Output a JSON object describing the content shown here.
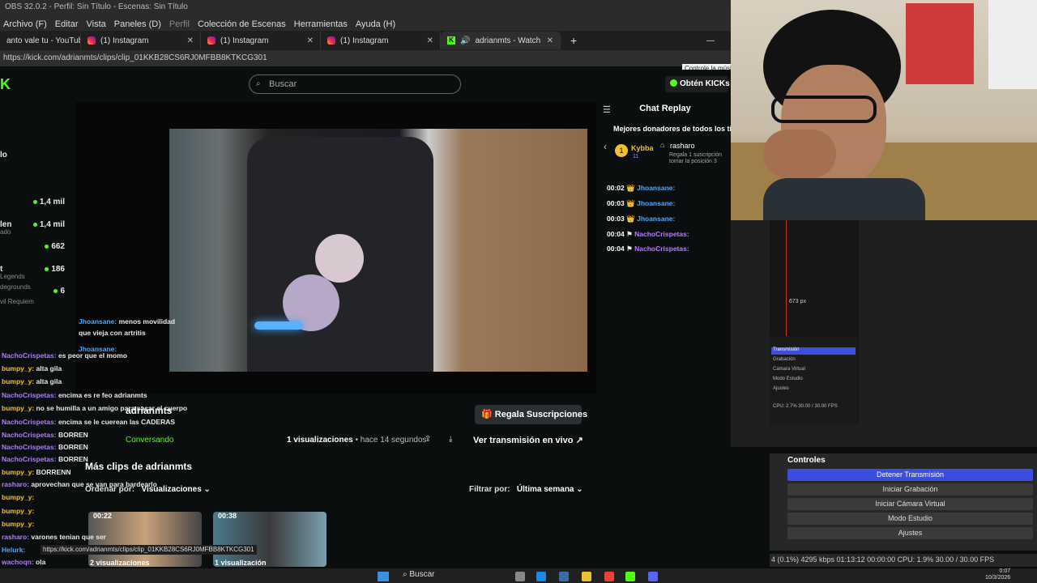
{
  "obs": {
    "title": "OBS 32.0.2 - Perfil: Sin Título - Escenas: Sin Título",
    "menu": [
      "Archivo (F)",
      "Editar",
      "Vista",
      "Paneles (D)",
      "Perfil",
      "Colección de Escenas",
      "Herramientas",
      "Ayuda (H)"
    ],
    "preview_px": "673 px",
    "mini_rows": [
      "Transmisión",
      "Grabación",
      "Cámara Virtual",
      "Modo Estudio",
      "Ajustes"
    ],
    "mini_status": "CPU: 2.7%   30.00 / 30.00 FPS",
    "controls_title": "Controles",
    "buttons": [
      "Detener Transmisión",
      "Iniciar Grabación",
      "Iniciar Cámara Virtual",
      "Modo Estudio",
      "Ajustes"
    ],
    "status": "4 (0.1%)   4295 kbps   01:13:12   00:00:00   CPU: 1.9%   30.00 / 30.00 FPS"
  },
  "browser": {
    "tabs": [
      {
        "label": "anto vale tu - YouTube",
        "icon": "youtube"
      },
      {
        "label": "(1) Instagram",
        "icon": "instagram"
      },
      {
        "label": "(1) Instagram",
        "icon": "instagram"
      },
      {
        "label": "(1) Instagram",
        "icon": "instagram"
      },
      {
        "label": "adrianmts - Watch clips on Ki",
        "icon": "kick"
      }
    ],
    "url": "https://kick.com/adrianmts/clips/clip_01KKB28CS6RJ0MFBB8KTKCG301",
    "tooltip": "Controle la músic",
    "status_url": "https://kick.com/adrianmts/clips/clip_01KKB28CS6RJ0MFBB8KTKCG301"
  },
  "kick": {
    "logo": "K",
    "search_placeholder": "Buscar",
    "get_kicks": "Obtén KICKs",
    "sidebar": [
      {
        "name": "lo",
        "sub": "",
        "value": ""
      },
      {
        "name": "",
        "sub": "",
        "value": "1,4 mil"
      },
      {
        "name": "len",
        "sub": "ado",
        "value": "1,4 mil"
      },
      {
        "name": "",
        "sub": "",
        "value": "662"
      },
      {
        "name": "t",
        "sub": "Legends",
        "value": "186"
      },
      {
        "name": "",
        "sub": "degrounds",
        "value": "6"
      },
      {
        "name": "",
        "sub": "vil Requiem",
        "value": ""
      }
    ],
    "chat_replay": {
      "title": "Chat Replay",
      "donors_title": "Mejores donadores de todos los ti",
      "donor_rank": "1",
      "donor_name": "Kybba",
      "donor_count": "11",
      "gifter_name": "rasharo",
      "gifter_text": "Regala 1 suscripción",
      "gifter_text2": "tomar la posición 3",
      "lines": [
        {
          "time": "00:02",
          "user": "Jhoansane:"
        },
        {
          "time": "00:03",
          "user": "Jhoansane:"
        },
        {
          "time": "00:03",
          "user": "Jhoansane:"
        },
        {
          "time": "00:04",
          "user": "NachoCrispetas:"
        },
        {
          "time": "00:04",
          "user": "NachoCrispetas:"
        }
      ]
    },
    "clip": {
      "user": "adrianmts",
      "status": "Conversando",
      "views": "1 visualizaciones",
      "ago": "• hace 14 segundos",
      "live_button": "Ver transmisión en vivo",
      "subs_button": "Regala Suscripciones",
      "more_clips": "Más clips de adrianmts",
      "order_label": "Ordenar por:",
      "order_value": "Visualizaciones",
      "filter_label": "Filtrar por:",
      "filter_value": "Última semana",
      "thumbs": [
        {
          "duration": "00:22",
          "views": "2 visualizaciones"
        },
        {
          "duration": "00:38",
          "views": "1 visualización"
        }
      ]
    }
  },
  "chat_overlay": [
    {
      "user": "Jhoansane:",
      "text": "menos movilidad",
      "cls": "b"
    },
    {
      "user": "",
      "text": "que vieja con artritis",
      "cls": ""
    },
    {
      "user": "Jhoansane:",
      "text": "",
      "cls": "b"
    },
    {
      "user": "NachoCrispetas:",
      "text": "es peor que el momo",
      "cls": "p"
    },
    {
      "user": "bumpy_y:",
      "text": "alta gila",
      "cls": "y"
    },
    {
      "user": "bumpy_y:",
      "text": "alta gila",
      "cls": "y"
    },
    {
      "user": "NachoCrispetas:",
      "text": "encima es re feo adrianmts",
      "cls": "p"
    },
    {
      "user": "bumpy_y:",
      "text": "no se humilla a un amigo para sacar el cuerpo",
      "cls": "y"
    },
    {
      "user": "NachoCrispetas:",
      "text": "encima se le cuerean las CADERAS",
      "cls": "p"
    },
    {
      "user": "NachoCrispetas:",
      "text": "BORREN",
      "cls": "p"
    },
    {
      "user": "NachoCrispetas:",
      "text": "BORREN",
      "cls": "p"
    },
    {
      "user": "NachoCrispetas:",
      "text": "BORREN",
      "cls": "p"
    },
    {
      "user": "bumpy_y:",
      "text": "BORRENN",
      "cls": "y"
    },
    {
      "user": "rasharo:",
      "text": "aprovechan que se van para bardearlo",
      "cls": "p"
    },
    {
      "user": "bumpy_y:",
      "text": "",
      "cls": "y"
    },
    {
      "user": "bumpy_y:",
      "text": "",
      "cls": "y"
    },
    {
      "user": "bumpy_y:",
      "text": "",
      "cls": "y"
    },
    {
      "user": "rasharo:",
      "text": "varones tenian que ser",
      "cls": "p"
    },
    {
      "user": "Helurk:",
      "text": "",
      "cls": "b"
    },
    {
      "user": "wachoqn:",
      "text": "ola",
      "cls": "p"
    }
  ],
  "taskbar": {
    "search": "Buscar",
    "time": "0:07",
    "date": "10/3/2026"
  },
  "colors": {
    "kick_green": "#53fc18",
    "obs_primary": "#3c4ee0"
  }
}
